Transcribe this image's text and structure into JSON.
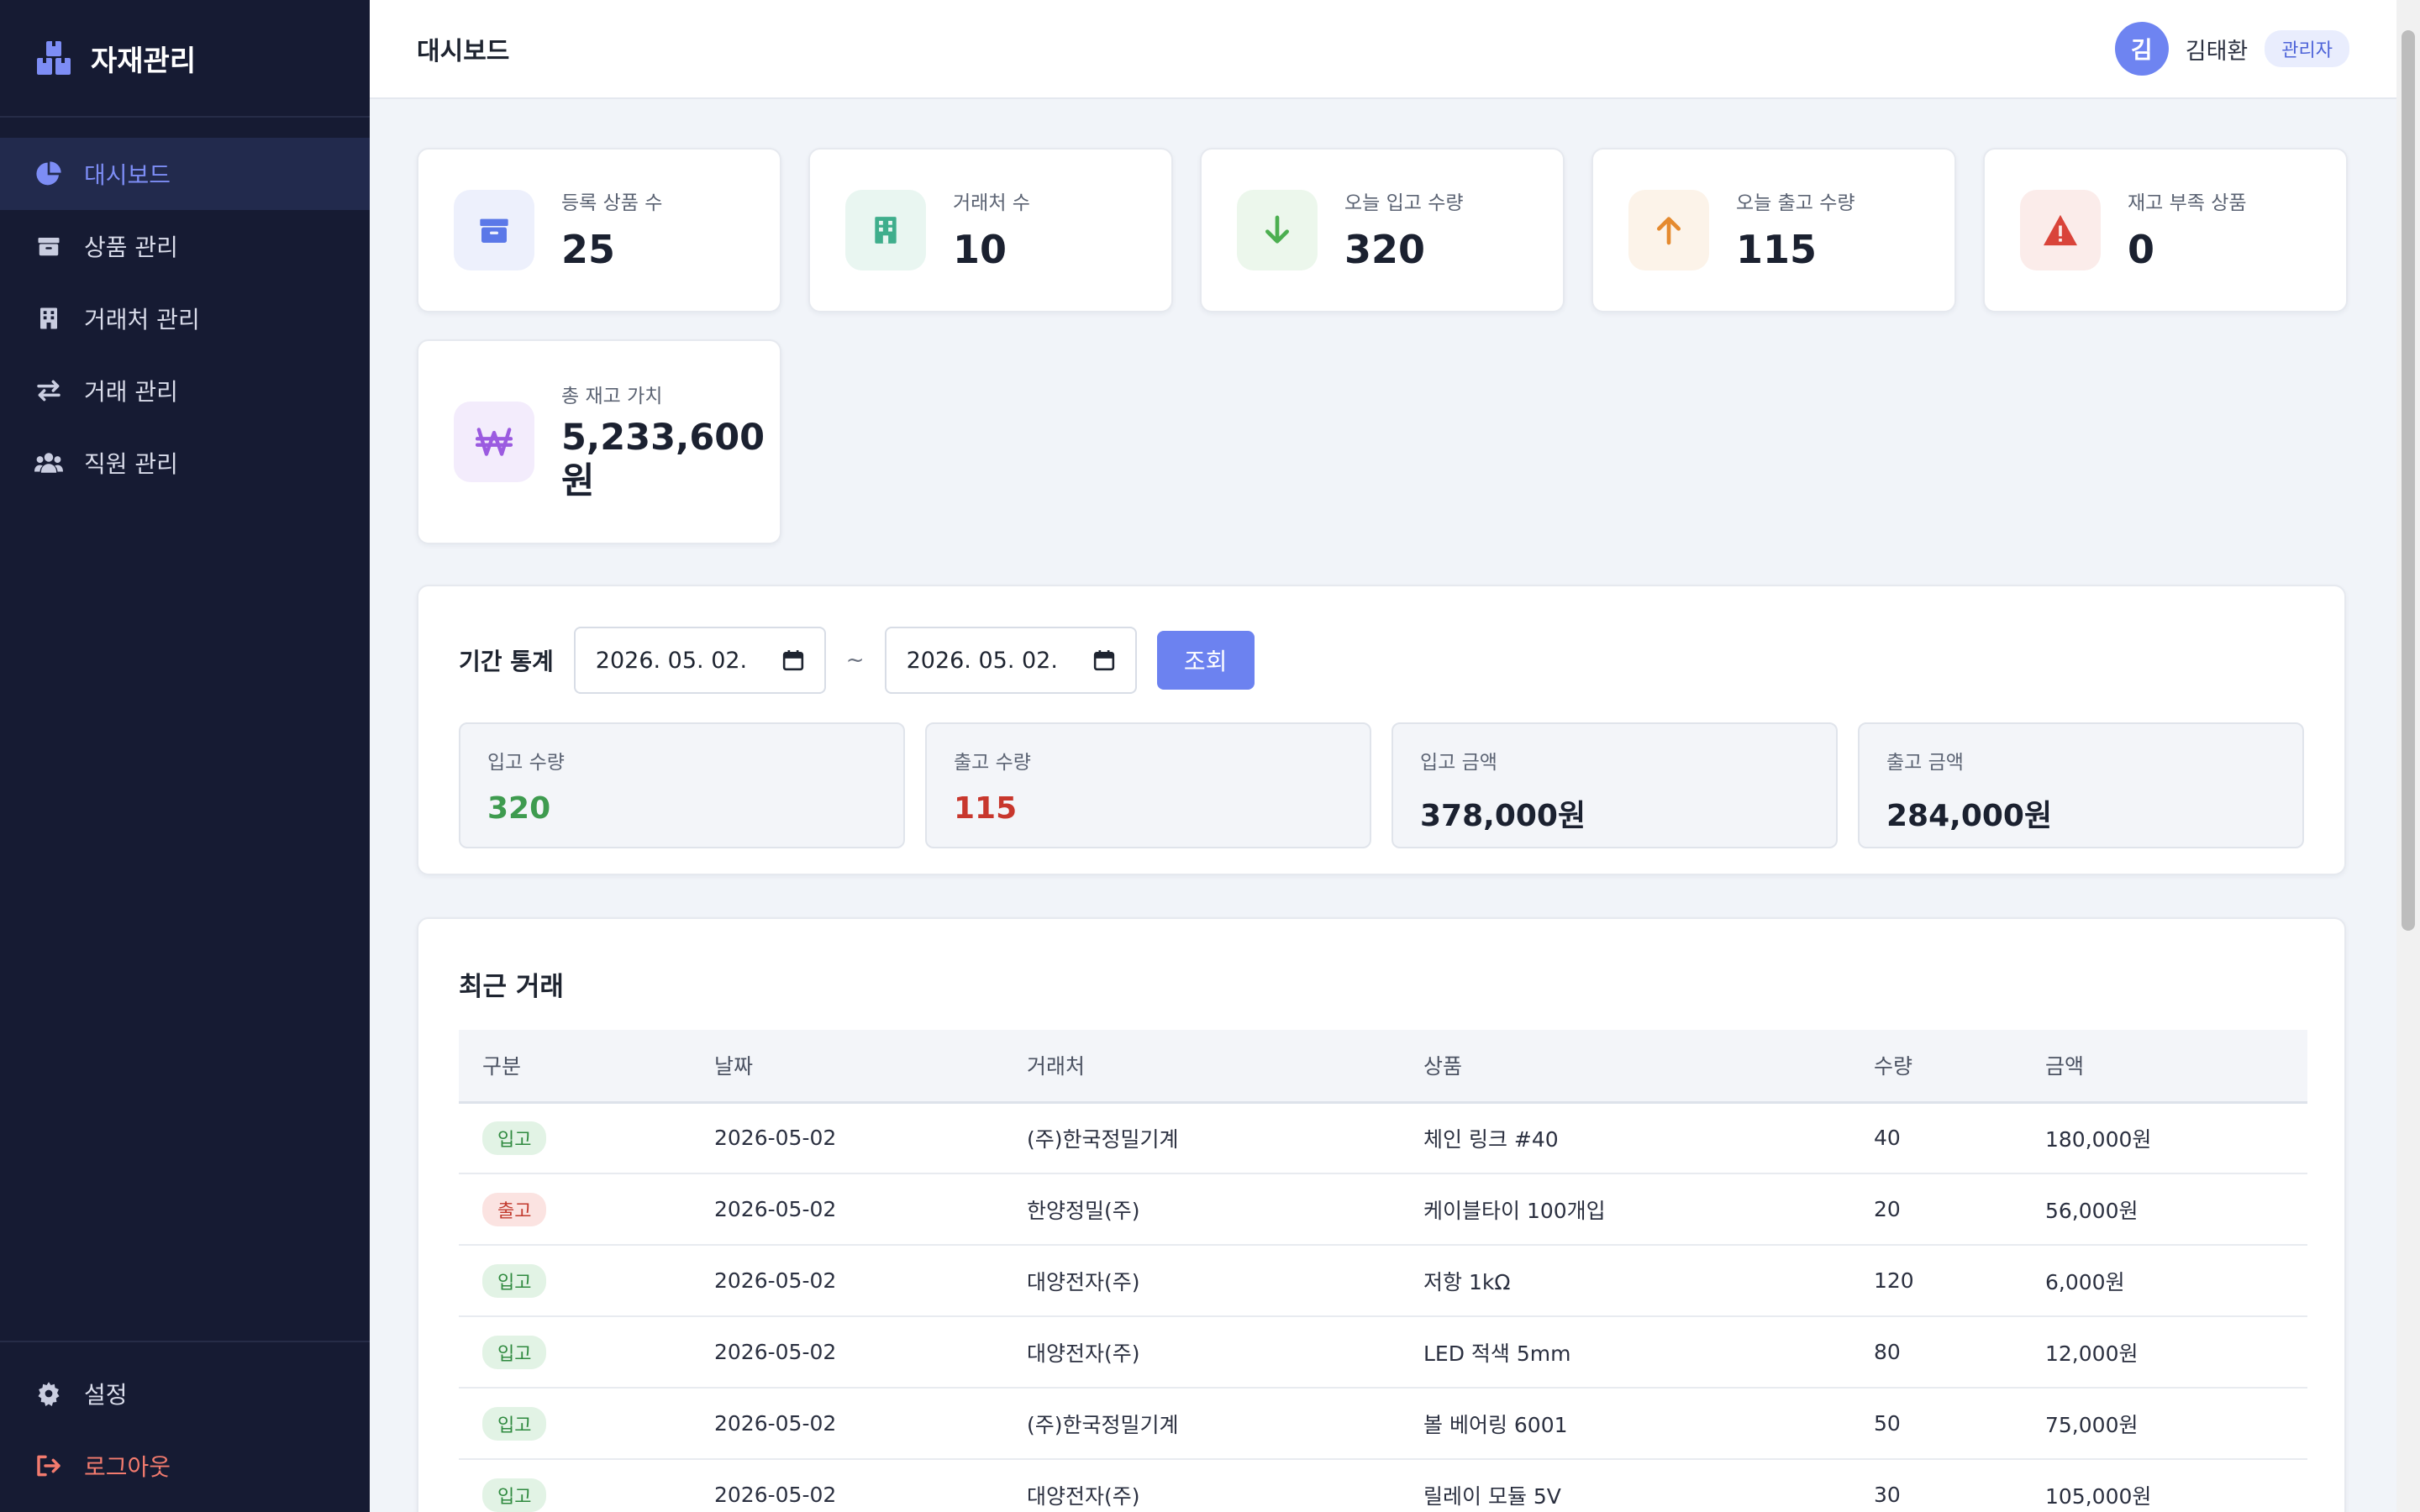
{
  "app": {
    "name": "자재관리"
  },
  "sidebar": {
    "items": [
      {
        "label": "대시보드",
        "icon": "pie-chart-icon",
        "active": true
      },
      {
        "label": "상품 관리",
        "icon": "box-icon"
      },
      {
        "label": "거래처 관리",
        "icon": "building-icon"
      },
      {
        "label": "거래 관리",
        "icon": "exchange-arrows-icon"
      },
      {
        "label": "직원 관리",
        "icon": "users-icon"
      }
    ],
    "bottom": [
      {
        "label": "설정",
        "icon": "gear-icon"
      },
      {
        "label": "로그아웃",
        "icon": "logout-icon"
      }
    ]
  },
  "header": {
    "title": "대시보드",
    "user": {
      "initial": "김",
      "name": "김태환",
      "role": "관리자"
    }
  },
  "stats": [
    {
      "label": "등록 상품 수",
      "value": "25",
      "icon": "box-icon",
      "color": "#5b78e8"
    },
    {
      "label": "거래처 수",
      "value": "10",
      "icon": "building-icon",
      "color": "#3fae8c"
    },
    {
      "label": "오늘 입고 수량",
      "value": "320",
      "icon": "arrow-down-icon",
      "color": "#4caf50"
    },
    {
      "label": "오늘 출고 수량",
      "value": "115",
      "icon": "arrow-up-icon",
      "color": "#e58a2f"
    },
    {
      "label": "재고 부족 상품",
      "value": "0",
      "icon": "warning-icon",
      "color": "#d9443a"
    },
    {
      "label": "총 재고 가치",
      "value_line1": "5,233,600",
      "value_line2": "원",
      "icon": "won-icon",
      "color": "#9b5be0"
    }
  ],
  "period": {
    "title": "기간 통계",
    "start": "2026. 05. 02.",
    "separator": "~",
    "end": "2026. 05. 02.",
    "button": "조회",
    "cards": [
      {
        "label": "입고 수량",
        "value": "320",
        "color": "#3e9b4f"
      },
      {
        "label": "출고 수량",
        "value": "115",
        "color": "#c8372d"
      },
      {
        "label": "입고 금액",
        "value": "378,000원"
      },
      {
        "label": "출고 금액",
        "value": "284,000원"
      }
    ]
  },
  "recent": {
    "title": "최근 거래",
    "columns": [
      "구분",
      "날짜",
      "거래처",
      "상품",
      "수량",
      "금액"
    ],
    "rows": [
      {
        "type": "입고",
        "kind": "in",
        "date": "2026-05-02",
        "partner": "(주)한국정밀기계",
        "product": "체인 링크 #40",
        "qty": "40",
        "amount": "180,000원"
      },
      {
        "type": "출고",
        "kind": "out",
        "date": "2026-05-02",
        "partner": "한양정밀(주)",
        "product": "케이블타이 100개입",
        "qty": "20",
        "amount": "56,000원"
      },
      {
        "type": "입고",
        "kind": "in",
        "date": "2026-05-02",
        "partner": "대양전자(주)",
        "product": "저항 1kΩ",
        "qty": "120",
        "amount": "6,000원"
      },
      {
        "type": "입고",
        "kind": "in",
        "date": "2026-05-02",
        "partner": "대양전자(주)",
        "product": "LED 적색 5mm",
        "qty": "80",
        "amount": "12,000원"
      },
      {
        "type": "입고",
        "kind": "in",
        "date": "2026-05-02",
        "partner": "(주)한국정밀기계",
        "product": "볼 베어링 6001",
        "qty": "50",
        "amount": "75,000원"
      },
      {
        "type": "입고",
        "kind": "in",
        "date": "2026-05-02",
        "partner": "대양전자(주)",
        "product": "릴레이 모듈 5V",
        "qty": "30",
        "amount": "105,000원"
      }
    ]
  }
}
